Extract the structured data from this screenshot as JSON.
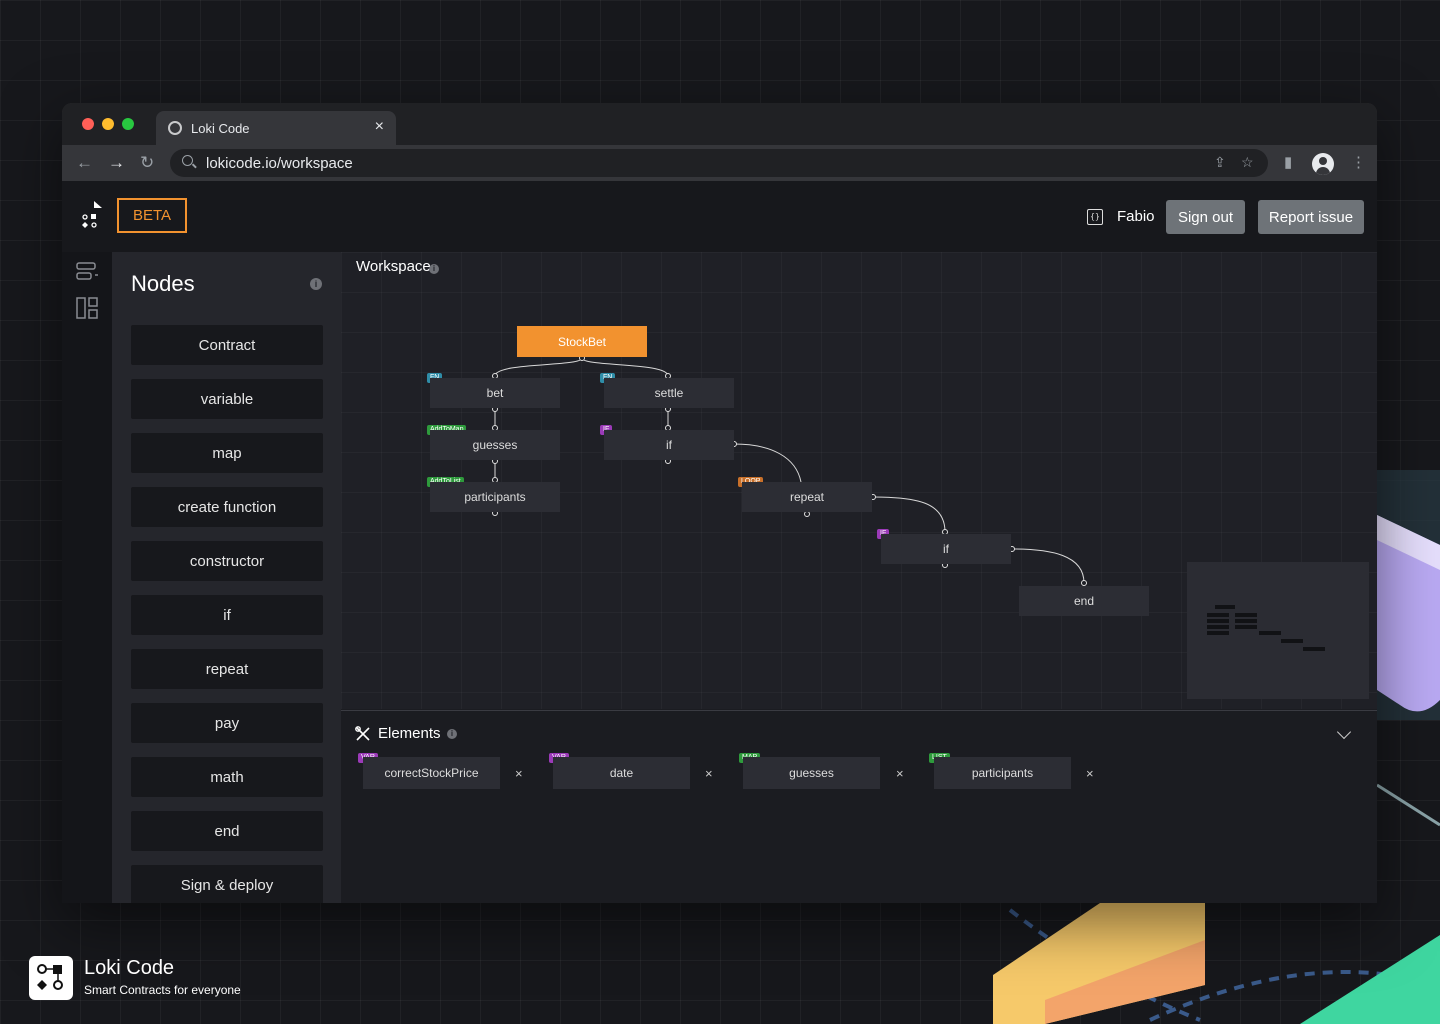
{
  "browser": {
    "tab_title": "Loki Code",
    "url": "lokicode.io/workspace",
    "traffic_colors": [
      "#ff5f57",
      "#febc2e",
      "#28c840"
    ]
  },
  "header": {
    "beta_label": "BETA",
    "user_name": "Fabio",
    "sign_out_label": "Sign out",
    "report_issue_label": "Report issue",
    "accent": "#f2922f"
  },
  "nodes_panel": {
    "title": "Nodes",
    "items": [
      "Contract",
      "variable",
      "map",
      "create function",
      "constructor",
      "if",
      "repeat",
      "pay",
      "math",
      "end",
      "Sign & deploy"
    ]
  },
  "workspace": {
    "title": "Workspace",
    "nodes": [
      {
        "label": "StockBet",
        "tag": ""
      },
      {
        "label": "bet",
        "tag": "FN"
      },
      {
        "label": "settle",
        "tag": "FN"
      },
      {
        "label": "guesses",
        "tag": "AddToMap"
      },
      {
        "label": "if",
        "tag": "IF"
      },
      {
        "label": "participants",
        "tag": "AddToList"
      },
      {
        "label": "repeat",
        "tag": "LOOP"
      },
      {
        "label": "if",
        "tag": "IF"
      },
      {
        "label": "end",
        "tag": ""
      }
    ]
  },
  "elements": {
    "title": "Elements",
    "items": [
      {
        "tag": "VAR",
        "label": "correctStockPrice"
      },
      {
        "tag": "VAR",
        "label": "date"
      },
      {
        "tag": "MAP",
        "label": "guesses"
      },
      {
        "tag": "LIST",
        "label": "participants"
      }
    ],
    "remove_glyph": "×"
  },
  "brand": {
    "name": "Loki Code",
    "tagline": "Smart Contracts for everyone"
  }
}
